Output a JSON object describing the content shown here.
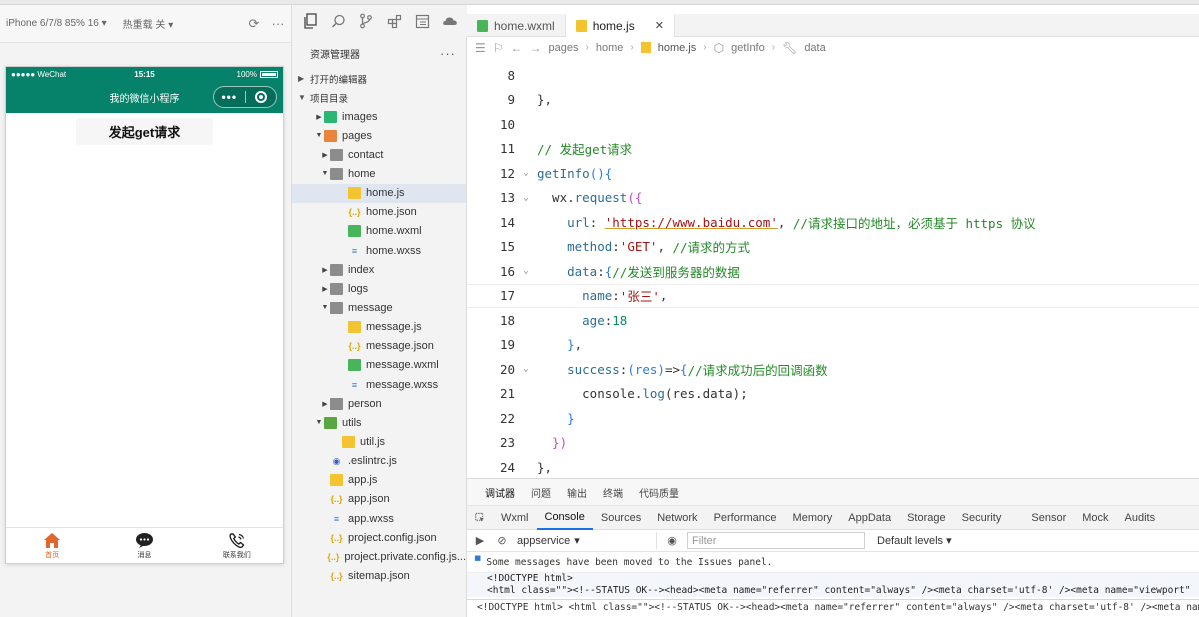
{
  "simulator": {
    "device_label": "iPhone 6/7/8 85% 16 ▾",
    "hot_reload_label": "热重载 关 ▾",
    "status_carrier": "●●●●● WeChat",
    "status_time": "15:15",
    "status_battery": "100%",
    "nav_title": "我的微信小程序",
    "capsule_more": "•••",
    "get_button": "发起get请求",
    "tabs": [
      {
        "label": "首页"
      },
      {
        "label": "消息"
      },
      {
        "label": "联系我们"
      }
    ],
    "active_color": "#e0662b",
    "navbar_color": "#06826a"
  },
  "explorer": {
    "title": "资源管理器",
    "more": "···",
    "section_open_editors": "打开的编辑器",
    "section_project": "项目目录",
    "tree": [
      {
        "label": "images",
        "icon": "folder-images-icon"
      },
      {
        "label": "pages",
        "icon": "folder-pages-icon"
      },
      {
        "label": "contact",
        "icon": "folder-icon"
      },
      {
        "label": "home",
        "icon": "folder-open-icon"
      },
      {
        "label": "home.js",
        "icon": "js-file-icon"
      },
      {
        "label": "home.json",
        "icon": "json-file-icon"
      },
      {
        "label": "home.wxml",
        "icon": "wxml-file-icon"
      },
      {
        "label": "home.wxss",
        "icon": "wxss-file-icon"
      },
      {
        "label": "index",
        "icon": "folder-icon"
      },
      {
        "label": "logs",
        "icon": "folder-icon"
      },
      {
        "label": "message",
        "icon": "folder-open-icon"
      },
      {
        "label": "message.js",
        "icon": "js-file-icon"
      },
      {
        "label": "message.json",
        "icon": "json-file-icon"
      },
      {
        "label": "message.wxml",
        "icon": "wxml-file-icon"
      },
      {
        "label": "message.wxss",
        "icon": "wxss-file-icon"
      },
      {
        "label": "person",
        "icon": "folder-icon"
      },
      {
        "label": "utils",
        "icon": "folder-utils-icon"
      },
      {
        "label": "util.js",
        "icon": "js-file-icon"
      },
      {
        "label": ".eslintrc.js",
        "icon": "eslint-file-icon"
      },
      {
        "label": "app.js",
        "icon": "js-file-icon"
      },
      {
        "label": "app.json",
        "icon": "json-file-icon"
      },
      {
        "label": "app.wxss",
        "icon": "wxss-file-icon"
      },
      {
        "label": "project.config.json",
        "icon": "json-file-icon"
      },
      {
        "label": "project.private.config.js...",
        "icon": "json-file-icon"
      },
      {
        "label": "sitemap.json",
        "icon": "json-file-icon"
      }
    ]
  },
  "editor": {
    "tabs": [
      {
        "label": "home.wxml"
      },
      {
        "label": "home.js",
        "close": "✕"
      }
    ],
    "breadcrumb": [
      "pages",
      "home",
      "home.js",
      "getInfo",
      "data"
    ],
    "lines": [
      {
        "n": "8"
      },
      {
        "n": "9",
        "t": [
          [
            "},",
            "code"
          ]
        ]
      },
      {
        "n": "10"
      },
      {
        "n": "11",
        "t": [
          [
            "// 发起get请求",
            "tok-com"
          ]
        ]
      },
      {
        "n": "12",
        "t": [
          [
            "getInfo",
            "tok-prop"
          ],
          [
            "(){",
            "tok-brace"
          ]
        ]
      },
      {
        "n": "13",
        "t": [
          [
            "  wx.",
            "code"
          ],
          [
            "request",
            "tok-prop"
          ],
          [
            "({",
            "tok-brace2"
          ]
        ]
      },
      {
        "n": "14",
        "t": [
          [
            "    url",
            "tok-prop"
          ],
          [
            ": ",
            "code"
          ],
          [
            "'https://www.baidu.com'",
            "tok-str link"
          ],
          [
            ", ",
            "code"
          ],
          [
            "//请求接口的地址，必须基于 https 协议",
            "tok-com"
          ]
        ]
      },
      {
        "n": "15",
        "t": [
          [
            "    method",
            "tok-prop"
          ],
          [
            ":",
            "code"
          ],
          [
            "'GET'",
            "tok-str"
          ],
          [
            ", ",
            "code"
          ],
          [
            "//请求的方式",
            "tok-com"
          ]
        ]
      },
      {
        "n": "16",
        "t": [
          [
            "    data",
            "tok-prop"
          ],
          [
            ":",
            "code"
          ],
          [
            "{",
            "tok-brace"
          ],
          [
            "//发送到服务器的数据",
            "tok-com"
          ]
        ]
      },
      {
        "n": "17",
        "t": [
          [
            "      name",
            "tok-prop"
          ],
          [
            ":",
            "code"
          ],
          [
            "'张三'",
            "tok-str"
          ],
          [
            ",",
            "code"
          ]
        ]
      },
      {
        "n": "18",
        "t": [
          [
            "      age",
            "tok-prop"
          ],
          [
            ":",
            "code"
          ],
          [
            "18",
            "tok-num"
          ]
        ]
      },
      {
        "n": "19",
        "t": [
          [
            "    }",
            "tok-brace"
          ],
          [
            ",",
            "code"
          ]
        ]
      },
      {
        "n": "20",
        "t": [
          [
            "    success",
            "tok-prop"
          ],
          [
            ":",
            "code"
          ],
          [
            "(res)",
            "tok-brace"
          ],
          [
            "=>",
            "code"
          ],
          [
            "{",
            "tok-brace"
          ],
          [
            "//请求成功后的回调函数",
            "tok-com"
          ]
        ]
      },
      {
        "n": "21",
        "t": [
          [
            "      console.",
            "code"
          ],
          [
            "log",
            "tok-prop"
          ],
          [
            "(res.data);",
            "code"
          ]
        ]
      },
      {
        "n": "22",
        "t": [
          [
            "    }",
            "tok-brace"
          ]
        ]
      },
      {
        "n": "23",
        "t": [
          [
            "  })",
            "tok-brace2"
          ]
        ]
      },
      {
        "n": "24",
        "t": [
          [
            "},",
            "code"
          ]
        ]
      }
    ]
  },
  "devtools": {
    "top_tabs": [
      "调试器",
      "问题",
      "输出",
      "终端",
      "代码质量"
    ],
    "panel_tabs": [
      "Wxml",
      "Console",
      "Sources",
      "Network",
      "Performance",
      "Memory",
      "AppData",
      "Storage",
      "Security",
      "Sensor",
      "Mock",
      "Audits"
    ],
    "context": "appservice",
    "filter_placeholder": "Filter",
    "levels": "Default levels ▾",
    "message": "Some messages have been moved to the Issues panel.",
    "html_line1": "<!DOCTYPE html>",
    "html_line2": "<html class=\"\"><!--STATUS OK--><head><meta name=\"referrer\" content=\"always\" /><meta charset='utf-8' /><meta name=\"viewport\" ",
    "last_line": "<!DOCTYPE html> <html class=\"\"><!--STATUS OK--><head><meta name=\"referrer\" content=\"always\" /><meta charset='utf-8' /><meta name=\"viewport\" "
  }
}
